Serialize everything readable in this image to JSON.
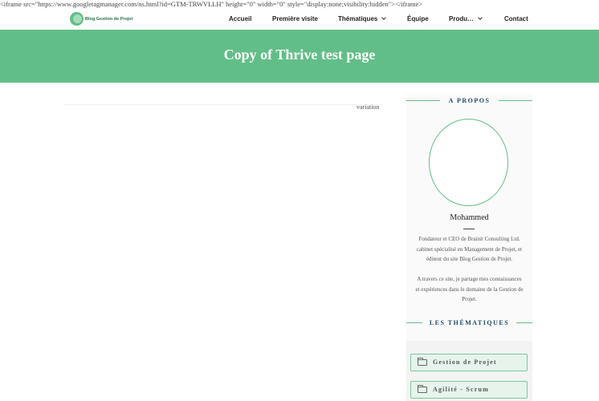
{
  "iframe_snippet": "<iframe src=\"https://www.googletagmanager.com/ns.html?id=GTM-TRWVLLH\" height=\"0\" width=\"0\" style=\"display:none;visibility:hidden\"></iframe>",
  "logo": {
    "text": "Blog Gestion de Projet",
    "icon": "leaf-logo-icon"
  },
  "nav": {
    "items": [
      {
        "label": "Accueil"
      },
      {
        "label": "Première visite"
      },
      {
        "label": "Thématiques",
        "dropdown": true
      },
      {
        "label": "Équipe"
      },
      {
        "label": "Produ…",
        "dropdown": true
      },
      {
        "label": "Contact"
      }
    ]
  },
  "hero": {
    "title": "Copy of Thrive test page"
  },
  "main": {
    "variation_text": "variation"
  },
  "sidebar": {
    "about": {
      "heading": "A PROPOS",
      "name": "Mohammed",
      "bio_1": [
        "Fondateur et CEO de Brainit Consulting Ltd.",
        "cabinet spécialisé en Management de Projet, et",
        "éditeur du site Blog Gestion de Projet."
      ],
      "bio_2": [
        "A travers ce site, je partage mes connaissances",
        "et expériences dans le domaine de la Gestion de",
        "Projet."
      ]
    },
    "themes": {
      "heading": "LES THÉMATIQUES",
      "items": [
        {
          "label": "Gestion de Projet",
          "icon": "folder-icon"
        },
        {
          "label": "Agilité - Scrum",
          "icon": "folder-icon"
        }
      ]
    }
  },
  "colors": {
    "accent": "#62be88",
    "heading_blue": "#1f4a66"
  }
}
